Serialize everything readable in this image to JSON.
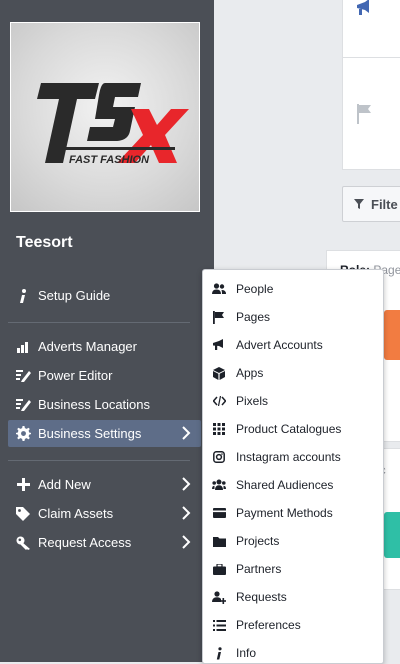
{
  "sidebar": {
    "business_name": "Teesort",
    "logo": {
      "brand_text": "TSX",
      "tagline": "FAST FASHION"
    },
    "items": [
      {
        "label": "Setup Guide",
        "icon": "info-icon"
      },
      {
        "label": "Adverts Manager",
        "icon": "chart-icon"
      },
      {
        "label": "Power Editor",
        "icon": "edit-icon"
      },
      {
        "label": "Business Locations",
        "icon": "edit-icon"
      },
      {
        "label": "Business Settings",
        "icon": "gear-icon",
        "active": true
      },
      {
        "label": "Add New",
        "icon": "plus-icon"
      },
      {
        "label": "Claim Assets",
        "icon": "tag-icon"
      },
      {
        "label": "Request Access",
        "icon": "key-icon"
      }
    ]
  },
  "content": {
    "filter_label": "Filte",
    "role_label": "Role:",
    "role_value": "Page",
    "truncated_label": "roc"
  },
  "menu": {
    "items": [
      {
        "label": "People",
        "icon": "people-icon"
      },
      {
        "label": "Pages",
        "icon": "flag-icon"
      },
      {
        "label": "Advert Accounts",
        "icon": "megaphone-icon"
      },
      {
        "label": "Apps",
        "icon": "cube-icon"
      },
      {
        "label": "Pixels",
        "icon": "code-icon"
      },
      {
        "label": "Product Catalogues",
        "icon": "grid-icon"
      },
      {
        "label": "Instagram accounts",
        "icon": "instagram-icon"
      },
      {
        "label": "Shared Audiences",
        "icon": "audience-icon"
      },
      {
        "label": "Payment Methods",
        "icon": "card-icon"
      },
      {
        "label": "Projects",
        "icon": "folder-icon"
      },
      {
        "label": "Partners",
        "icon": "briefcase-icon"
      },
      {
        "label": "Requests",
        "icon": "person-add-icon"
      },
      {
        "label": "Preferences",
        "icon": "list-icon"
      },
      {
        "label": "Info",
        "icon": "info-icon"
      }
    ]
  },
  "colors": {
    "sidebar_bg": "#4b4f56",
    "active_item": "#5e6d88",
    "brand_red": "#e8262b",
    "accent_blue": "#4267b2"
  }
}
